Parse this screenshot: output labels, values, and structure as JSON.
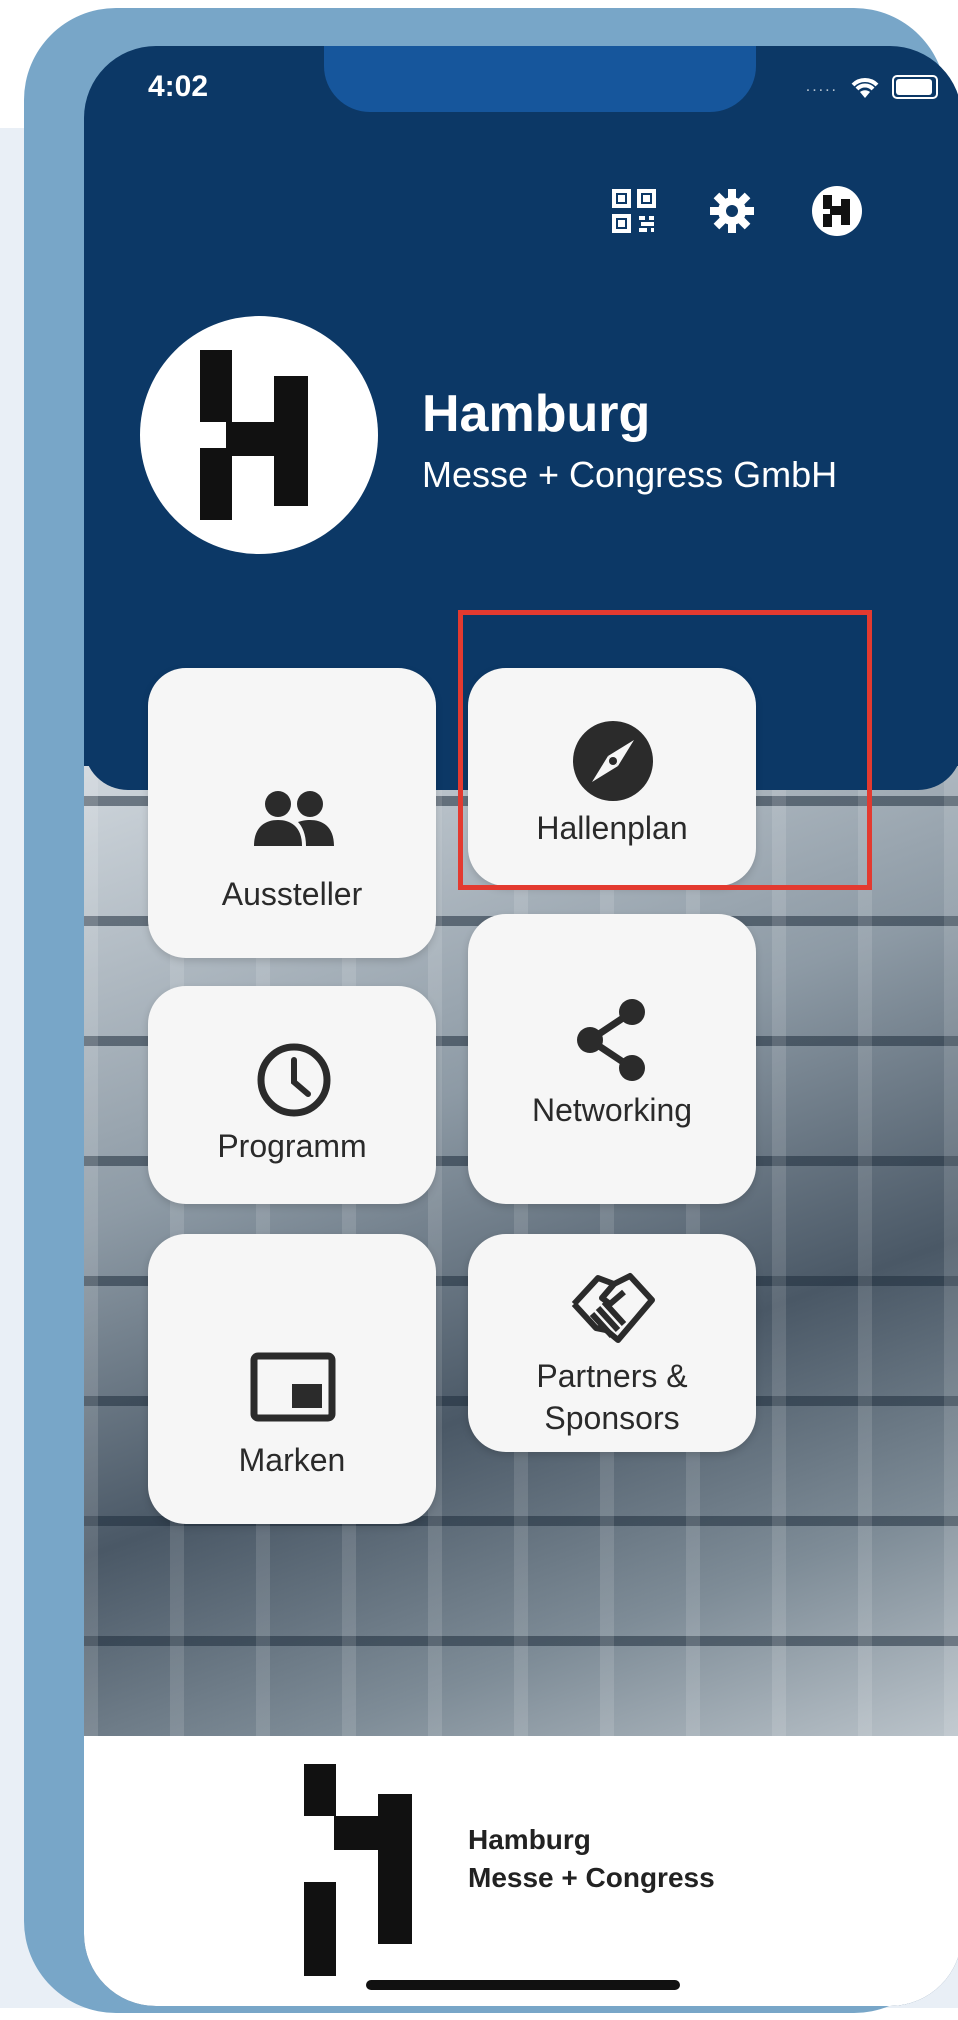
{
  "status_bar": {
    "time": "4:02",
    "signal": "....."
  },
  "toolbar": {
    "icons": [
      "qr-code-icon",
      "gear-icon",
      "account-icon"
    ]
  },
  "header": {
    "title": "Hamburg",
    "subtitle": "Messe + Congress GmbH"
  },
  "tiles": [
    {
      "label": "Aussteller",
      "icon": "people-icon"
    },
    {
      "label": "Hallenplan",
      "icon": "compass-icon",
      "highlighted": true
    },
    {
      "label": "Programm",
      "icon": "clock-icon"
    },
    {
      "label": "Networking",
      "icon": "share-icon"
    },
    {
      "label": "Marken",
      "icon": "picture-in-picture-icon"
    },
    {
      "label": "Partners &\nSponsors",
      "icon": "handshake-icon"
    }
  ],
  "footer": {
    "line1": "Hamburg",
    "line2": "Messe + Congress"
  },
  "colors": {
    "header": "#0c3866",
    "frame": "#78a6c8",
    "highlight": "#e33a30",
    "tile": "#f6f6f6"
  }
}
